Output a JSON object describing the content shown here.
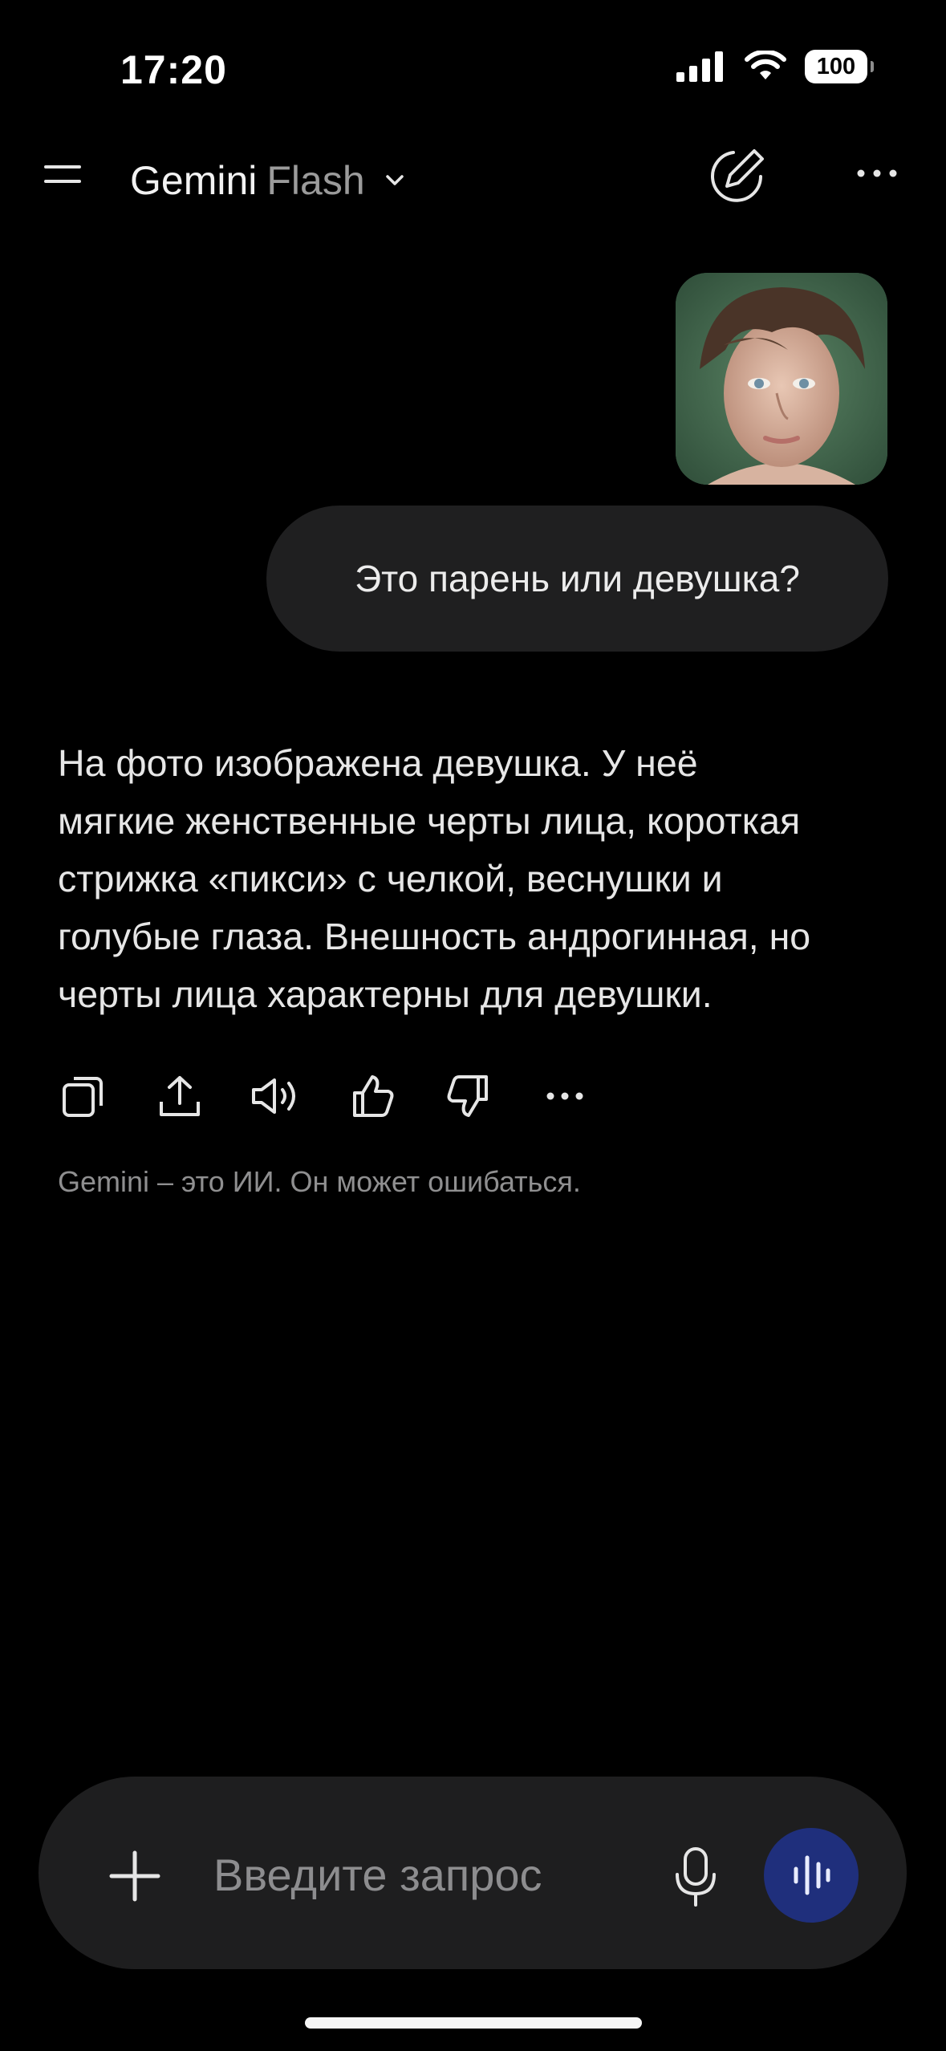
{
  "status_bar": {
    "time": "17:20",
    "battery": "100"
  },
  "header": {
    "title_main": "Gemini",
    "title_sub": "Flash"
  },
  "chat": {
    "user_message": "Это парень или девушка?",
    "answer_lines": [
      "На фото изображена девушка. У неё",
      "мягкие женственные черты лица, короткая",
      "стрижка «пикси» с челкой, веснушки и",
      "голубые глаза. Внешность андрогинная, но",
      "черты лица характерны для девушки."
    ],
    "disclaimer": "Gemini – это ИИ. Он может ошибаться."
  },
  "actions": [
    "copy-icon",
    "share-icon",
    "speaker-icon",
    "thumbs-up-icon",
    "thumbs-down-icon",
    "more-icon"
  ],
  "input": {
    "placeholder": "Введите запрос"
  },
  "colors": {
    "accent": "#1f2f7c",
    "bubble": "#1f1f20",
    "input_bg": "#1e1e1f"
  }
}
